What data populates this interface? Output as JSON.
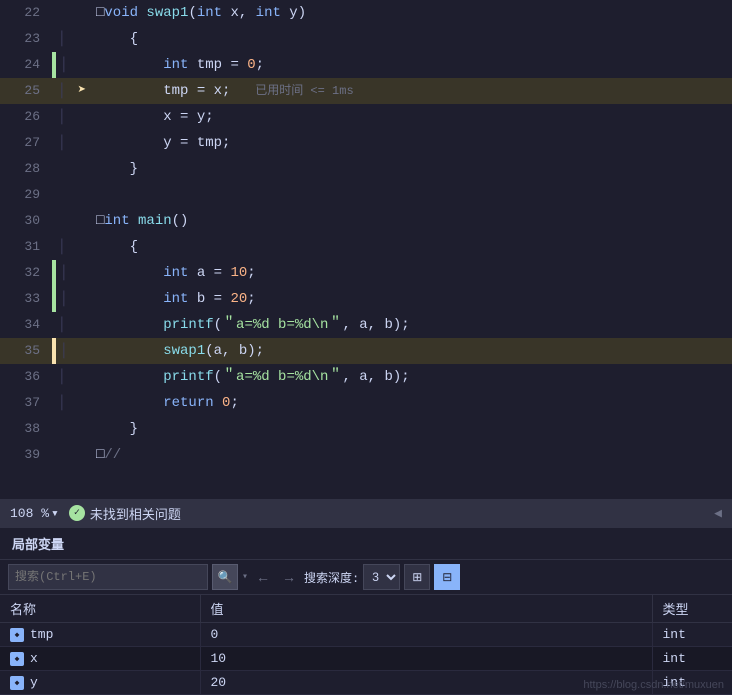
{
  "editor": {
    "lines": [
      {
        "num": 22,
        "fold": "⊟",
        "bar": "none",
        "arrow": false,
        "tokens": [
          {
            "t": "fold",
            "v": "⊟"
          },
          {
            "t": "kw",
            "v": "void"
          },
          {
            "t": "punc",
            "v": " "
          },
          {
            "t": "fn",
            "v": "swap1"
          },
          {
            "t": "punc",
            "v": "("
          },
          {
            "t": "type",
            "v": "int"
          },
          {
            "t": "punc",
            "v": " x, "
          },
          {
            "t": "type",
            "v": "int"
          },
          {
            "t": "punc",
            "v": " y)"
          }
        ],
        "raw": "⊟void swap1(int x, int y)"
      },
      {
        "num": 23,
        "bar": "none",
        "arrow": false,
        "raw": "    {"
      },
      {
        "num": 24,
        "bar": "green",
        "arrow": false,
        "raw": "        int tmp = 0;"
      },
      {
        "num": 25,
        "bar": "none",
        "arrow": true,
        "raw": "        tmp = x;",
        "hint": "已用时间 <= 1ms"
      },
      {
        "num": 26,
        "bar": "none",
        "arrow": false,
        "raw": "        x = y;"
      },
      {
        "num": 27,
        "bar": "none",
        "arrow": false,
        "raw": "        y = tmp;"
      },
      {
        "num": 28,
        "bar": "none",
        "arrow": false,
        "raw": "    }"
      },
      {
        "num": 29,
        "bar": "yellow",
        "arrow": false,
        "raw": ""
      },
      {
        "num": 30,
        "bar": "none",
        "arrow": false,
        "raw": "⊟int main()"
      },
      {
        "num": 31,
        "bar": "none",
        "arrow": false,
        "raw": "    {"
      },
      {
        "num": 32,
        "bar": "green",
        "arrow": false,
        "raw": "        int a = 10;"
      },
      {
        "num": 33,
        "bar": "green",
        "arrow": false,
        "raw": "        int b = 20;"
      },
      {
        "num": 34,
        "bar": "none",
        "arrow": false,
        "raw": "        printf(＂a=%d b=%d\\n＂, a, b);"
      },
      {
        "num": 35,
        "bar": "yellow",
        "arrow": false,
        "raw": "        swap1(a, b);"
      },
      {
        "num": 36,
        "bar": "none",
        "arrow": false,
        "raw": "        printf(＂a=%d b=%d\\n＂, a, b);"
      },
      {
        "num": 37,
        "bar": "none",
        "arrow": false,
        "raw": "        return 0;"
      },
      {
        "num": 38,
        "bar": "none",
        "arrow": false,
        "raw": "    }"
      },
      {
        "num": 39,
        "bar": "none",
        "arrow": false,
        "raw": "⊟//"
      }
    ]
  },
  "statusBar": {
    "zoom": "108 %",
    "zoomDropdown": "▾",
    "statusOk": "✓",
    "statusText": "未找到相关问题",
    "arrowRight": "◀"
  },
  "locals": {
    "header": "局部变量",
    "searchPlaceholder": "搜索(Ctrl+E)",
    "searchIcon": "🔍",
    "depthLabel": "搜索深度:",
    "depthValue": "3",
    "navBack": "←",
    "navForward": "→",
    "tableHeaders": [
      "名称",
      "值",
      "类型"
    ],
    "rows": [
      {
        "name": "tmp",
        "value": "0",
        "type": "int",
        "isZero": true
      },
      {
        "name": "x",
        "value": "10",
        "type": "int",
        "isZero": false
      },
      {
        "name": "y",
        "value": "20",
        "type": "int",
        "isZero": false
      }
    ],
    "watermark": "https://blog.csdn.net/muxuen"
  }
}
